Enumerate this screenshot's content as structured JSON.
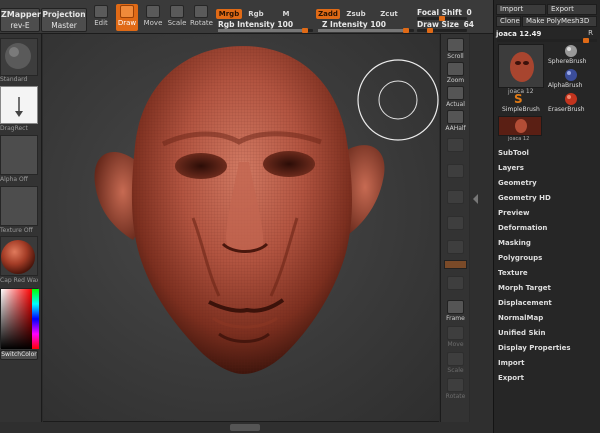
{
  "toolbar": {
    "zmapper": "ZMapper",
    "rev_e": "rev-E",
    "projection": "Projection",
    "master": "Master",
    "edit": "Edit",
    "draw": "Draw",
    "move": "Move",
    "scale": "Scale",
    "rotate": "Rotate",
    "mrgb": "Mrgb",
    "rgb": "Rgb",
    "m": "M",
    "rgb_intensity_label": "Rgb Intensity",
    "rgb_intensity_value": "100",
    "rgb_intensity_fraction": 0.95,
    "zadd": "Zadd",
    "zsub": "Zsub",
    "zcut": "Zcut",
    "z_intensity_label": "Z Intensity",
    "z_intensity_value": "100",
    "z_intensity_fraction": 0.95,
    "focal_shift_label": "Focal Shift",
    "focal_shift_value": "0",
    "draw_size_label": "Draw Size",
    "draw_size_value": "64",
    "accent_color": "#e06a16"
  },
  "left_shelf": {
    "standard": "Standard",
    "dragrect": "DragRect",
    "alpha_off": "Alpha Off",
    "texture_off": "Texture Off",
    "material": "Cap Red Wax",
    "switch_color": "SwitchColor"
  },
  "right_strip": {
    "scroll": "Scroll",
    "zoom": "Zoom",
    "actual": "Actual",
    "aahalf": "AAHalf",
    "frame": "Frame",
    "move": "Move",
    "scale": "Scale",
    "rotate": "Rotate"
  },
  "tray": {
    "import": "Import",
    "export": "Export",
    "clone": "Clone",
    "make_polymesh": "Make PolyMesh3D",
    "tool_name": "joaca 12.49",
    "tool_suffix": "R",
    "thumb_label": "joaca 12",
    "sphere_brush": "SphereBrush",
    "alpha_brush": "AlphaBrush",
    "simple_brush": "SimpleBrush",
    "eraser_brush": "EraserBrush",
    "small_thumb_label": "joaca 12",
    "menu": [
      "SubTool",
      "Layers",
      "Geometry",
      "Geometry HD",
      "Preview",
      "Deformation",
      "Masking",
      "Polygroups",
      "Texture",
      "Morph Target",
      "Displacement",
      "NormalMap",
      "Unified Skin",
      "Display Properties",
      "Import",
      "Export"
    ]
  }
}
